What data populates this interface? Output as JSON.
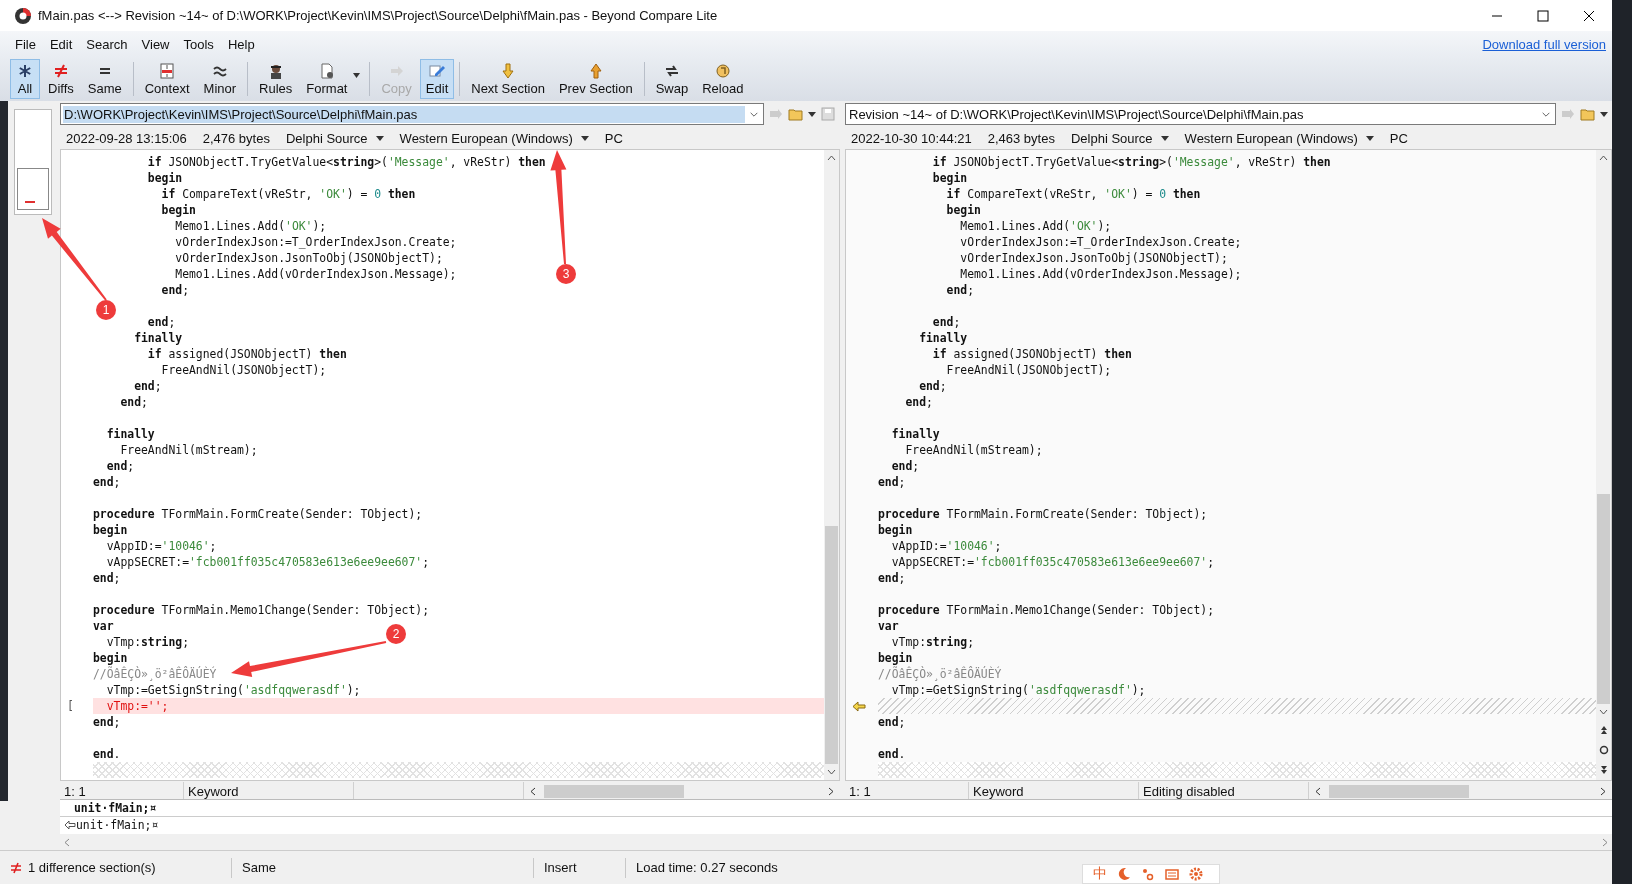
{
  "window": {
    "title": "fMain.pas <--> Revision ~14~ of D:\\WORK\\Project\\Kevin\\IMS\\Project\\Source\\Delphi\\fMain.pas - Beyond Compare Lite"
  },
  "menu": [
    "File",
    "Edit",
    "Search",
    "View",
    "Tools",
    "Help"
  ],
  "download_link": "Download full version",
  "toolbar": [
    {
      "label": "All",
      "selected": true,
      "disabled": false,
      "dropdown": false
    },
    {
      "label": "Diffs",
      "selected": false,
      "disabled": false,
      "dropdown": false
    },
    {
      "label": "Same",
      "selected": false,
      "disabled": false,
      "dropdown": false
    },
    {
      "label": "Context",
      "selected": false,
      "disabled": false,
      "dropdown": false
    },
    {
      "label": "Minor",
      "selected": false,
      "disabled": false,
      "dropdown": false
    },
    {
      "label": "Rules",
      "selected": false,
      "disabled": false,
      "dropdown": false
    },
    {
      "label": "Format",
      "selected": false,
      "disabled": false,
      "dropdown": true
    },
    {
      "label": "Copy",
      "selected": false,
      "disabled": true,
      "dropdown": false
    },
    {
      "label": "Edit",
      "selected": true,
      "disabled": false,
      "dropdown": false
    },
    {
      "label": "Next Section",
      "selected": false,
      "disabled": false,
      "dropdown": false
    },
    {
      "label": "Prev Section",
      "selected": false,
      "disabled": false,
      "dropdown": false
    },
    {
      "label": "Swap",
      "selected": false,
      "disabled": false,
      "dropdown": false
    },
    {
      "label": "Reload",
      "selected": false,
      "disabled": false,
      "dropdown": false
    }
  ],
  "panes": [
    {
      "path": "D:\\WORK\\Project\\Kevin\\IMS\\Project\\Source\\Delphi\\fMain.pas",
      "path_selected": true,
      "date": "2022-09-28 13:15:06",
      "size": "2,476 bytes",
      "format": "Delphi Source",
      "encoding": "Western European (Windows)",
      "line_endings": "PC",
      "lines": [
        {
          "kind": "code",
          "segs": [
            {
              "kind": "keyword",
              "text": "        if"
            },
            {
              "text": " JSONObjectT.TryGetValue<"
            },
            {
              "kind": "keyword",
              "text": "string"
            },
            {
              "text": ">("
            },
            {
              "kind": "string",
              "text": "'Message'"
            },
            {
              "text": ", vReStr) "
            },
            {
              "kind": "keyword",
              "text": "then"
            }
          ]
        },
        {
          "kind": "code",
          "segs": [
            {
              "kind": "keyword",
              "text": "        begin"
            }
          ]
        },
        {
          "kind": "code",
          "segs": [
            {
              "kind": "keyword",
              "text": "          if"
            },
            {
              "text": " CompareText(vReStr, "
            },
            {
              "kind": "string",
              "text": "'OK'"
            },
            {
              "text": ") = "
            },
            {
              "kind": "number",
              "text": "0"
            },
            {
              "kind": "keyword",
              "text": " then"
            }
          ]
        },
        {
          "kind": "code",
          "segs": [
            {
              "kind": "keyword",
              "text": "          begin"
            }
          ]
        },
        {
          "kind": "code",
          "segs": [
            {
              "text": "            Memo1.Lines.Add("
            },
            {
              "kind": "string",
              "text": "'OK'"
            },
            {
              "text": ");"
            }
          ]
        },
        {
          "kind": "code",
          "segs": [
            {
              "text": "            vOrderIndexJson:=T_OrderIndexJson.Create;"
            }
          ]
        },
        {
          "kind": "code",
          "segs": [
            {
              "text": "            vOrderIndexJson.JsonToObj(JSONObjectT);"
            }
          ]
        },
        {
          "kind": "code",
          "segs": [
            {
              "text": "            Memo1.Lines.Add(vOrderIndexJson.Message);"
            }
          ]
        },
        {
          "kind": "code",
          "segs": [
            {
              "kind": "keyword",
              "text": "          end"
            },
            {
              "text": ";"
            }
          ]
        },
        {
          "kind": "empty"
        },
        {
          "kind": "code",
          "segs": [
            {
              "kind": "keyword",
              "text": "        end"
            },
            {
              "text": ";"
            }
          ]
        },
        {
          "kind": "code",
          "segs": [
            {
              "kind": "keyword",
              "text": "      finally"
            }
          ]
        },
        {
          "kind": "code",
          "segs": [
            {
              "kind": "keyword",
              "text": "        if"
            },
            {
              "text": " assigned(JSONObjectT) "
            },
            {
              "kind": "keyword",
              "text": "then"
            }
          ]
        },
        {
          "kind": "code",
          "segs": [
            {
              "text": "          FreeAndNil(JSONObjectT);"
            }
          ]
        },
        {
          "kind": "code",
          "segs": [
            {
              "kind": "keyword",
              "text": "      end"
            },
            {
              "text": ";"
            }
          ]
        },
        {
          "kind": "code",
          "segs": [
            {
              "kind": "keyword",
              "text": "    end"
            },
            {
              "text": ";"
            }
          ]
        },
        {
          "kind": "empty"
        },
        {
          "kind": "code",
          "segs": [
            {
              "kind": "keyword",
              "text": "  finally"
            }
          ]
        },
        {
          "kind": "code",
          "segs": [
            {
              "text": "    FreeAndNil(mStream);"
            }
          ]
        },
        {
          "kind": "code",
          "segs": [
            {
              "kind": "keyword",
              "text": "  end"
            },
            {
              "text": ";"
            }
          ]
        },
        {
          "kind": "code",
          "segs": [
            {
              "kind": "keyword",
              "text": "end"
            },
            {
              "text": ";"
            }
          ]
        },
        {
          "kind": "empty"
        },
        {
          "kind": "code",
          "segs": [
            {
              "kind": "keyword",
              "text": "procedure"
            },
            {
              "text": " TFormMain.FormCreate(Sender: TObject);"
            }
          ]
        },
        {
          "kind": "code",
          "segs": [
            {
              "kind": "keyword",
              "text": "begin"
            }
          ]
        },
        {
          "kind": "code",
          "segs": [
            {
              "text": "  vAppID:="
            },
            {
              "kind": "string",
              "text": "'10046'"
            },
            {
              "text": ";"
            }
          ]
        },
        {
          "kind": "code",
          "segs": [
            {
              "text": "  vAppSECRET:="
            },
            {
              "kind": "string",
              "text": "'fcb001ff035c470583e613e6ee9ee607'"
            },
            {
              "text": ";"
            }
          ]
        },
        {
          "kind": "code",
          "segs": [
            {
              "kind": "keyword",
              "text": "end"
            },
            {
              "text": ";"
            }
          ]
        },
        {
          "kind": "empty"
        },
        {
          "kind": "code",
          "segs": [
            {
              "kind": "keyword",
              "text": "procedure"
            },
            {
              "text": " TFormMain.Memo1Change(Sender: TObject);"
            }
          ]
        },
        {
          "kind": "code",
          "segs": [
            {
              "kind": "keyword",
              "text": "var"
            }
          ]
        },
        {
          "kind": "code",
          "segs": [
            {
              "text": "  vTmp:"
            },
            {
              "kind": "keyword",
              "text": "string"
            },
            {
              "text": ";"
            }
          ]
        },
        {
          "kind": "code",
          "segs": [
            {
              "kind": "keyword",
              "text": "begin"
            }
          ]
        },
        {
          "kind": "code",
          "segs": [
            {
              "kind": "comment",
              "text": "//ÕâÊÇÒ»¸ö²âÊÔÄÚÈÝ"
            }
          ]
        },
        {
          "kind": "code",
          "segs": [
            {
              "text": "  vTmp:=GetSignString("
            },
            {
              "kind": "string",
              "text": "'asdfqqwerasdf'"
            },
            {
              "text": ");"
            }
          ]
        },
        {
          "kind": "diff",
          "marker": "[",
          "segs": [
            {
              "text": "  vTmp:='';"
            }
          ]
        },
        {
          "kind": "code",
          "segs": [
            {
              "kind": "keyword",
              "text": "end"
            },
            {
              "text": ";"
            }
          ]
        },
        {
          "kind": "empty"
        },
        {
          "kind": "code",
          "segs": [
            {
              "kind": "keyword",
              "text": "end"
            },
            {
              "text": "."
            }
          ]
        }
      ],
      "cursor": "1: 1",
      "token": "Keyword"
    },
    {
      "path": "Revision ~14~ of D:\\WORK\\Project\\Kevin\\IMS\\Project\\Source\\Delphi\\fMain.pas",
      "path_selected": false,
      "date": "2022-10-30 10:44:21",
      "size": "2,463 bytes",
      "format": "Delphi Source",
      "encoding": "Western European (Windows)",
      "line_endings": "PC",
      "lines": [
        {
          "kind": "code",
          "segs": [
            {
              "kind": "keyword",
              "text": "        if"
            },
            {
              "text": " JSONObjectT.TryGetValue<"
            },
            {
              "kind": "keyword",
              "text": "string"
            },
            {
              "text": ">("
            },
            {
              "kind": "string",
              "text": "'Message'"
            },
            {
              "text": ", vReStr) "
            },
            {
              "kind": "keyword",
              "text": "then"
            }
          ]
        },
        {
          "kind": "code",
          "segs": [
            {
              "kind": "keyword",
              "text": "        begin"
            }
          ]
        },
        {
          "kind": "code",
          "segs": [
            {
              "kind": "keyword",
              "text": "          if"
            },
            {
              "text": " CompareText(vReStr, "
            },
            {
              "kind": "string",
              "text": "'OK'"
            },
            {
              "text": ") = "
            },
            {
              "kind": "number",
              "text": "0"
            },
            {
              "kind": "keyword",
              "text": " then"
            }
          ]
        },
        {
          "kind": "code",
          "segs": [
            {
              "kind": "keyword",
              "text": "          begin"
            }
          ]
        },
        {
          "kind": "code",
          "segs": [
            {
              "text": "            Memo1.Lines.Add("
            },
            {
              "kind": "string",
              "text": "'OK'"
            },
            {
              "text": ");"
            }
          ]
        },
        {
          "kind": "code",
          "segs": [
            {
              "text": "            vOrderIndexJson:=T_OrderIndexJson.Create;"
            }
          ]
        },
        {
          "kind": "code",
          "segs": [
            {
              "text": "            vOrderIndexJson.JsonToObj(JSONObjectT);"
            }
          ]
        },
        {
          "kind": "code",
          "segs": [
            {
              "text": "            Memo1.Lines.Add(vOrderIndexJson.Message);"
            }
          ]
        },
        {
          "kind": "code",
          "segs": [
            {
              "kind": "keyword",
              "text": "          end"
            },
            {
              "text": ";"
            }
          ]
        },
        {
          "kind": "empty"
        },
        {
          "kind": "code",
          "segs": [
            {
              "kind": "keyword",
              "text": "        end"
            },
            {
              "text": ";"
            }
          ]
        },
        {
          "kind": "code",
          "segs": [
            {
              "kind": "keyword",
              "text": "      finally"
            }
          ]
        },
        {
          "kind": "code",
          "segs": [
            {
              "kind": "keyword",
              "text": "        if"
            },
            {
              "text": " assigned(JSONObjectT) "
            },
            {
              "kind": "keyword",
              "text": "then"
            }
          ]
        },
        {
          "kind": "code",
          "segs": [
            {
              "text": "          FreeAndNil(JSONObjectT);"
            }
          ]
        },
        {
          "kind": "code",
          "segs": [
            {
              "kind": "keyword",
              "text": "      end"
            },
            {
              "text": ";"
            }
          ]
        },
        {
          "kind": "code",
          "segs": [
            {
              "kind": "keyword",
              "text": "    end"
            },
            {
              "text": ";"
            }
          ]
        },
        {
          "kind": "empty"
        },
        {
          "kind": "code",
          "segs": [
            {
              "kind": "keyword",
              "text": "  finally"
            }
          ]
        },
        {
          "kind": "code",
          "segs": [
            {
              "text": "    FreeAndNil(mStream);"
            }
          ]
        },
        {
          "kind": "code",
          "segs": [
            {
              "kind": "keyword",
              "text": "  end"
            },
            {
              "text": ";"
            }
          ]
        },
        {
          "kind": "code",
          "segs": [
            {
              "kind": "keyword",
              "text": "end"
            },
            {
              "text": ";"
            }
          ]
        },
        {
          "kind": "empty"
        },
        {
          "kind": "code",
          "segs": [
            {
              "kind": "keyword",
              "text": "procedure"
            },
            {
              "text": " TFormMain.FormCreate(Sender: TObject);"
            }
          ]
        },
        {
          "kind": "code",
          "segs": [
            {
              "kind": "keyword",
              "text": "begin"
            }
          ]
        },
        {
          "kind": "code",
          "segs": [
            {
              "text": "  vAppID:="
            },
            {
              "kind": "string",
              "text": "'10046'"
            },
            {
              "text": ";"
            }
          ]
        },
        {
          "kind": "code",
          "segs": [
            {
              "text": "  vAppSECRET:="
            },
            {
              "kind": "string",
              "text": "'fcb001ff035c470583e613e6ee9ee607'"
            },
            {
              "text": ";"
            }
          ]
        },
        {
          "kind": "code",
          "segs": [
            {
              "kind": "keyword",
              "text": "end"
            },
            {
              "text": ";"
            }
          ]
        },
        {
          "kind": "empty"
        },
        {
          "kind": "code",
          "segs": [
            {
              "kind": "keyword",
              "text": "procedure"
            },
            {
              "text": " TFormMain.Memo1Change(Sender: TObject);"
            }
          ]
        },
        {
          "kind": "code",
          "segs": [
            {
              "kind": "keyword",
              "text": "var"
            }
          ]
        },
        {
          "kind": "code",
          "segs": [
            {
              "text": "  vTmp:"
            },
            {
              "kind": "keyword",
              "text": "string"
            },
            {
              "text": ";"
            }
          ]
        },
        {
          "kind": "code",
          "segs": [
            {
              "kind": "keyword",
              "text": "begin"
            }
          ]
        },
        {
          "kind": "code",
          "segs": [
            {
              "kind": "comment",
              "text": "//ÕâÊÇÒ»¸ö²âÊÔÄÚÈÝ"
            }
          ]
        },
        {
          "kind": "code",
          "segs": [
            {
              "text": "  vTmp:=GetSignString("
            },
            {
              "kind": "string",
              "text": "'asdfqqwerasdf'"
            },
            {
              "text": ");"
            }
          ]
        },
        {
          "kind": "gap"
        },
        {
          "kind": "code",
          "segs": [
            {
              "kind": "keyword",
              "text": "end"
            },
            {
              "text": ";"
            }
          ]
        },
        {
          "kind": "empty"
        },
        {
          "kind": "code",
          "segs": [
            {
              "kind": "keyword",
              "text": "end"
            },
            {
              "text": "."
            }
          ]
        }
      ],
      "cursor": "1: 1",
      "token": "Keyword",
      "mode": "Editing disabled"
    }
  ],
  "line_compare": [
    "unit·fMain;¤",
    "unit·fMain;¤"
  ],
  "status_bar": {
    "differences": "1 difference section(s)",
    "state": "Same",
    "insert_mode": "Insert",
    "load_time": "Load time: 0.27 seconds"
  },
  "ime_bar": {
    "label": "中"
  },
  "annotations": [
    {
      "number": "1"
    },
    {
      "number": "2"
    },
    {
      "number": "3"
    }
  ]
}
